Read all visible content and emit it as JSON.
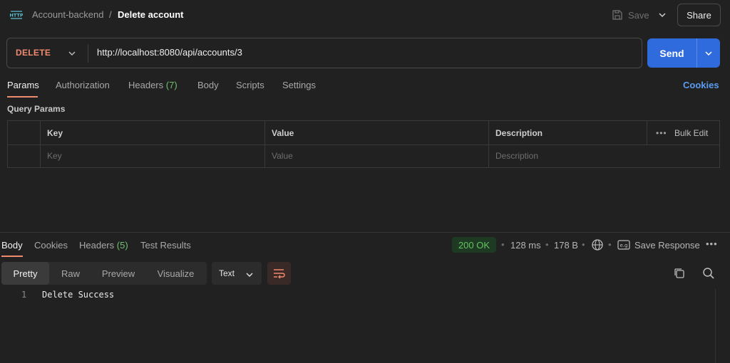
{
  "breadcrumb": {
    "parent": "Account-backend",
    "separator": "/",
    "current": "Delete account"
  },
  "toolbar": {
    "save_label": "Save",
    "share_label": "Share"
  },
  "request": {
    "method": "DELETE",
    "url": "http://localhost:8080/api/accounts/3",
    "send_label": "Send"
  },
  "request_tabs": {
    "params": "Params",
    "authorization": "Authorization",
    "headers": "Headers",
    "headers_count": "(7)",
    "body": "Body",
    "scripts": "Scripts",
    "settings": "Settings",
    "cookies": "Cookies"
  },
  "query_params": {
    "title": "Query Params",
    "columns": {
      "key": "Key",
      "value": "Value",
      "description": "Description"
    },
    "placeholders": {
      "key": "Key",
      "value": "Value",
      "description": "Description"
    },
    "bulk_edit": "Bulk Edit",
    "more": "•••"
  },
  "response_tabs": {
    "body": "Body",
    "cookies": "Cookies",
    "headers": "Headers",
    "headers_count": "(5)",
    "test_results": "Test Results"
  },
  "response_meta": {
    "status": "200 OK",
    "time": "128 ms",
    "size": "178 B",
    "dot": "•",
    "save_response": "Save Response",
    "more": "•••"
  },
  "view": {
    "options": {
      "pretty": "Pretty",
      "raw": "Raw",
      "preview": "Preview",
      "visualize": "Visualize"
    },
    "format": "Text"
  },
  "response_body": {
    "line_number": "1",
    "text": "Delete Success"
  },
  "colors": {
    "accent": "#f08a6f",
    "send": "#2f6bdc",
    "status_ok": "#62c462",
    "link": "#5b9cf0"
  },
  "icons": [
    "http-icon",
    "save-icon",
    "chevron-down-icon",
    "globe-icon",
    "save-response-icon",
    "wrap-lines-icon",
    "copy-icon",
    "search-icon"
  ]
}
